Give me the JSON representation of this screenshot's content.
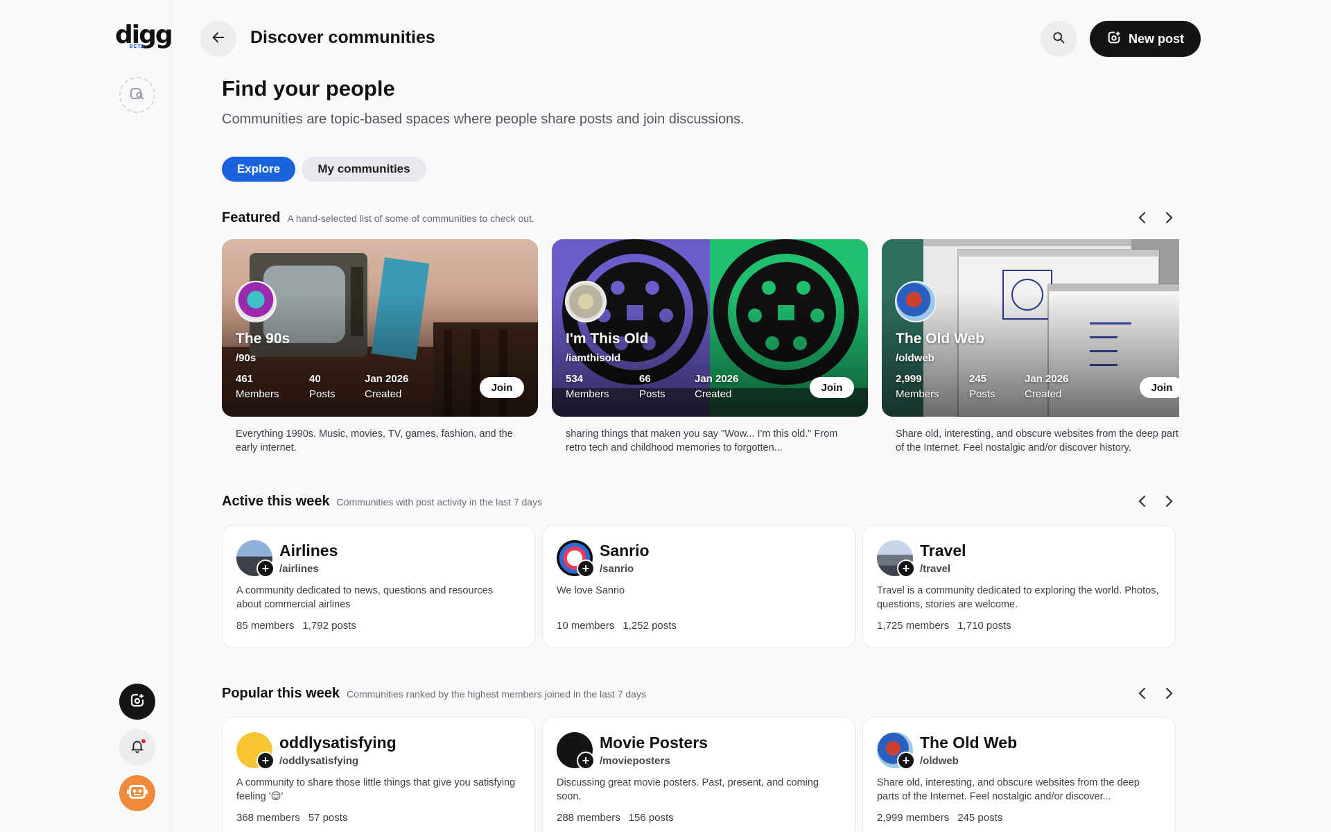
{
  "sidebar": {
    "logo_text": "digg",
    "logo_badge": "BETA",
    "items": [
      {
        "name": "compose-outline"
      },
      {
        "name": "compose"
      },
      {
        "name": "notifications",
        "has_dot": true
      },
      {
        "name": "profile-avatar"
      }
    ]
  },
  "header": {
    "title": "Discover communities",
    "new_post_label": "New post"
  },
  "intro": {
    "heading": "Find your people",
    "subheading": "Communities are topic-based spaces where people share posts and join discussions."
  },
  "tabs": [
    {
      "label": "Explore",
      "active": true
    },
    {
      "label": "My communities",
      "active": false
    }
  ],
  "featured": {
    "title": "Featured",
    "description": "A hand-selected list of some of communities to check out.",
    "cards": [
      {
        "name": "The 90s",
        "slug": "/90s",
        "members": "461",
        "members_label": "Members",
        "posts": "40",
        "posts_label": "Posts",
        "created": "Jan 2026",
        "created_label": "Created",
        "join_label": "Join",
        "description": "Everything 1990s. Music, movies, TV, games, fashion, and the early internet."
      },
      {
        "name": "I'm This Old",
        "slug": "/iamthisold",
        "members": "534",
        "members_label": "Members",
        "posts": "66",
        "posts_label": "Posts",
        "created": "Jan 2026",
        "created_label": "Created",
        "join_label": "Join",
        "description": "sharing things that maken you say \"Wow... I'm this old.\" From retro tech and childhood memories to forgotten..."
      },
      {
        "name": "The Old Web",
        "slug": "/oldweb",
        "members": "2,999",
        "members_label": "Members",
        "posts": "245",
        "posts_label": "Posts",
        "created": "Jan 2026",
        "created_label": "Created",
        "join_label": "Join",
        "description": "Share old, interesting, and obscure websites from the deep parts of the Internet. Feel nostalgic and/or discover history."
      }
    ]
  },
  "active": {
    "title": "Active this week",
    "description": "Communities with post activity in the last 7 days",
    "cards": [
      {
        "name": "Airlines",
        "slug": "/airlines",
        "description": "A community dedicated to news, questions and resources about commercial airlines",
        "members": "85 members",
        "posts": "1,792 posts"
      },
      {
        "name": "Sanrio",
        "slug": "/sanrio",
        "description": "We love Sanrio",
        "members": "10 members",
        "posts": "1,252 posts"
      },
      {
        "name": "Travel",
        "slug": "/travel",
        "description": "Travel is a community dedicated to exploring the world. Photos, questions, stories are welcome.",
        "members": "1,725 members",
        "posts": "1,710 posts"
      }
    ]
  },
  "popular": {
    "title": "Popular this week",
    "description": "Communities ranked by the highest members joined in the last 7 days",
    "cards": [
      {
        "name": "oddlysatisfying",
        "slug": "/oddlysatisfying",
        "description": "A community to share those little things that give you satisfying feeling '😌'",
        "members": "368 members",
        "posts": "57 posts"
      },
      {
        "name": "Movie Posters",
        "slug": "/movieposters",
        "description": "Discussing great movie posters. Past, present, and coming soon.",
        "members": "288 members",
        "posts": "156 posts"
      },
      {
        "name": "The Old Web",
        "slug": "/oldweb",
        "description": "Share old, interesting, and obscure websites from the deep parts of the Internet. Feel nostalgic and/or discover...",
        "members": "2,999 members",
        "posts": "245 posts"
      }
    ]
  },
  "colors": {
    "accent": "#1b63dd",
    "dark": "#141414",
    "notification_dot": "#e0293a",
    "avatar_orange": "#f08a3a"
  }
}
